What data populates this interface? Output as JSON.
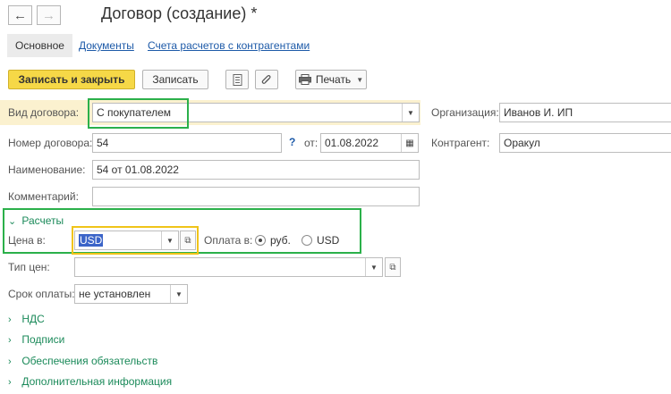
{
  "window": {
    "title": "Договор (создание) *"
  },
  "nav": {
    "back": "←",
    "forward": "→"
  },
  "tabs": [
    {
      "label": "Основное"
    },
    {
      "label": "Документы"
    },
    {
      "label": "Счета расчетов с контрагентами"
    }
  ],
  "toolbar": {
    "save_close": "Записать и закрыть",
    "save": "Записать",
    "print": "Печать",
    "icons": [
      "report-icon",
      "paperclip-icon",
      "printer-icon"
    ]
  },
  "form": {
    "contract_type": {
      "label": "Вид договора:",
      "value": "С покупателем"
    },
    "number": {
      "label": "Номер договора:",
      "value": "54",
      "help": "?"
    },
    "date": {
      "label": "от:",
      "value": "01.08.2022"
    },
    "name": {
      "label": "Наименование:",
      "value": "54 от 01.08.2022"
    },
    "comment": {
      "label": "Комментарий:",
      "value": ""
    },
    "organization": {
      "label": "Организация:",
      "value": "Иванов И. ИП"
    },
    "counterparty": {
      "label": "Контрагент:",
      "value": "Оракул"
    }
  },
  "settlements": {
    "header": "Расчеты",
    "price_in": {
      "label": "Цена в:",
      "value": "USD"
    },
    "payment_in": {
      "label": "Оплата в:",
      "options": [
        "руб.",
        "USD"
      ],
      "selected": "руб."
    },
    "price_type": {
      "label": "Тип цен:",
      "value": ""
    },
    "payment_term": {
      "label": "Срок оплаты:",
      "value": "не установлен"
    }
  },
  "collapsed_sections": [
    "НДС",
    "Подписи",
    "Обеспечения обязательств",
    "Дополнительная информация"
  ],
  "colors": {
    "primary_button": "#f6d847",
    "highlight_green": "#2bb04a",
    "highlight_yellow": "#f0c419",
    "link": "#1d5aa8",
    "section": "#1b8a5a"
  }
}
